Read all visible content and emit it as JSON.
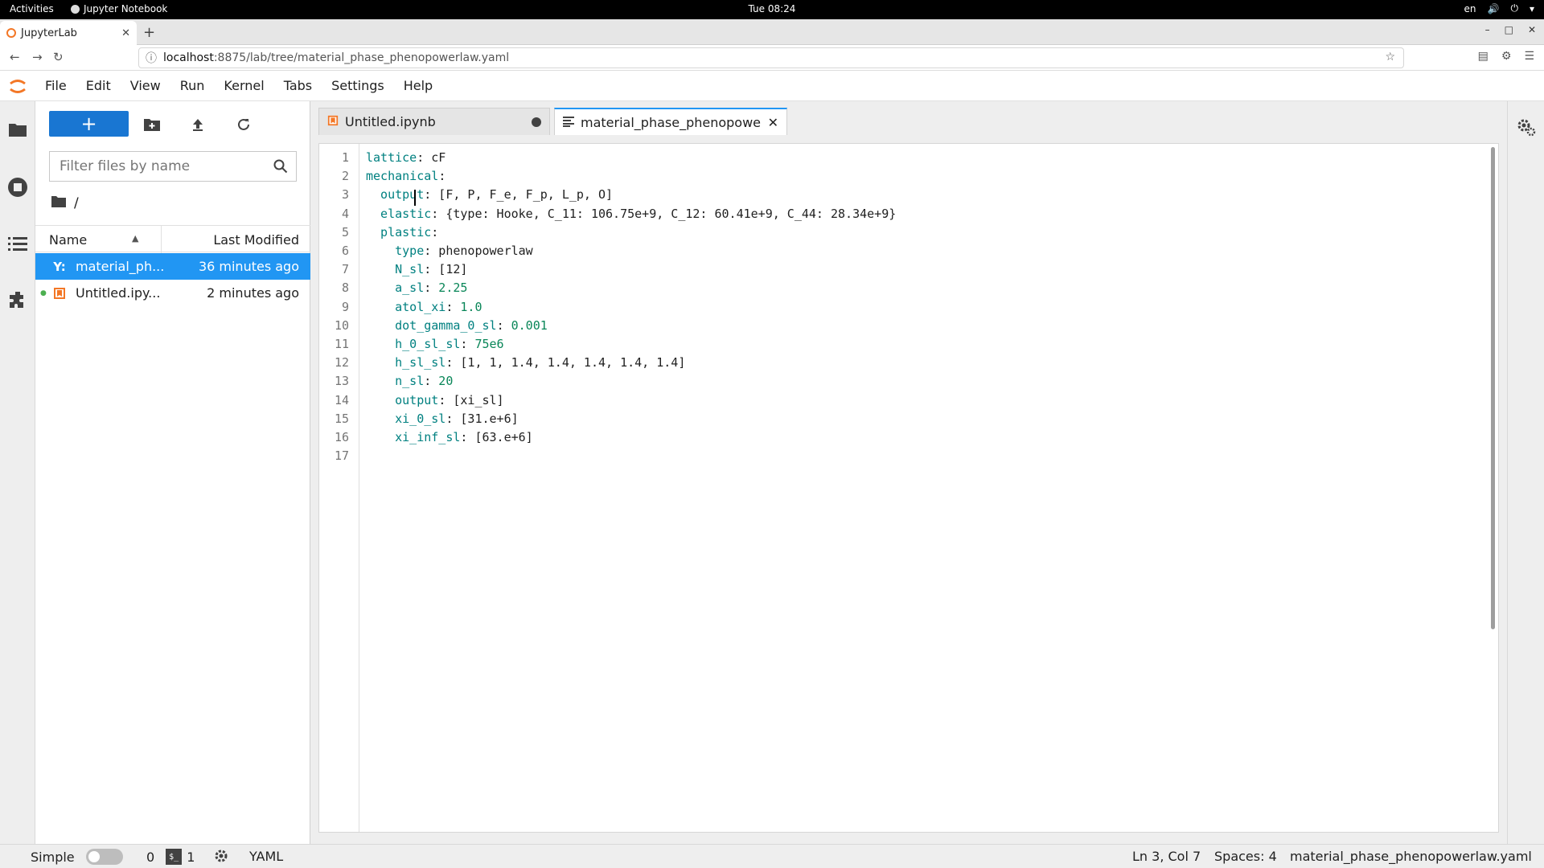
{
  "os_bar": {
    "activities": "Activities",
    "app_name": "Jupyter Notebook",
    "clock": "Tue 08:24",
    "lang": "en"
  },
  "browser": {
    "tab_title": "JupyterLab",
    "url_host": "localhost",
    "url_rest": ":8875/lab/tree/material_phase_phenopowerlaw.yaml"
  },
  "menubar": {
    "items": [
      "File",
      "Edit",
      "View",
      "Run",
      "Kernel",
      "Tabs",
      "Settings",
      "Help"
    ]
  },
  "filebrowser": {
    "new_button": "+",
    "filter_placeholder": "Filter files by name",
    "breadcrumb": "/",
    "col_name": "Name",
    "col_modified": "Last Modified",
    "files": [
      {
        "icon": "Y:",
        "name": "material_ph...",
        "modified": "36 minutes ago"
      },
      {
        "icon": "notebook-icon",
        "name": "Untitled.ipy...",
        "modified": "2 minutes ago"
      }
    ]
  },
  "doc_tabs": {
    "notebook": "Untitled.ipynb",
    "yaml": "material_phase_phenopower"
  },
  "editor": {
    "lines": [
      {
        "n": "1",
        "key": "lattice",
        "rest": " cF"
      },
      {
        "n": "2",
        "key": "mechanical",
        "rest": ""
      },
      {
        "n": "3",
        "key": "  output",
        "rest": " [F, P, F_e, F_p, L_p, O]"
      },
      {
        "n": "4",
        "key": "  elastic",
        "rest": " {type: Hooke, C_11: 106.75e+9, C_12: 60.41e+9, C_44: 28.34e+9}"
      },
      {
        "n": "5",
        "key": "  plastic",
        "rest": ""
      },
      {
        "n": "6",
        "key": "    type",
        "rest": " phenopowerlaw"
      },
      {
        "n": "7",
        "key": "    N_sl",
        "rest": " [12]"
      },
      {
        "n": "8",
        "key": "    a_sl",
        "rest": " 2.25"
      },
      {
        "n": "9",
        "key": "    atol_xi",
        "rest": " 1.0"
      },
      {
        "n": "10",
        "key": "    dot_gamma_0_sl",
        "rest": " 0.001"
      },
      {
        "n": "11",
        "key": "    h_0_sl_sl",
        "rest": " 75e6"
      },
      {
        "n": "12",
        "key": "    h_sl_sl",
        "rest": " [1, 1, 1.4, 1.4, 1.4, 1.4, 1.4]"
      },
      {
        "n": "13",
        "key": "    n_sl",
        "rest": " 20"
      },
      {
        "n": "14",
        "key": "    output",
        "rest": " [xi_sl]"
      },
      {
        "n": "15",
        "key": "    xi_0_sl",
        "rest": " [31.e+6]"
      },
      {
        "n": "16",
        "key": "    xi_inf_sl",
        "rest": " [63.e+6]"
      },
      {
        "n": "17",
        "key": "",
        "rest": ""
      }
    ]
  },
  "statusbar": {
    "mode": "Simple",
    "kernels": "0",
    "terminals": "1",
    "file_type": "YAML",
    "cursor_pos": "Ln 3, Col 7",
    "spaces": "Spaces: 4",
    "file_name": "material_phase_phenopowerlaw.yaml"
  },
  "colors": {
    "accent": "#2196f3",
    "launcher": "#1976d2",
    "yaml_key": "#008080",
    "yaml_number": "#098658"
  }
}
